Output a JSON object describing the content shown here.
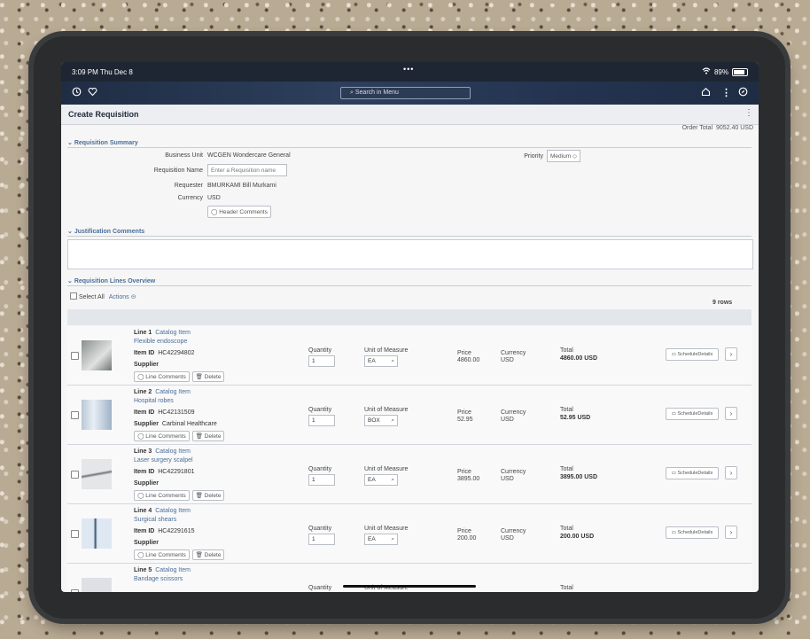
{
  "status": {
    "time": "3:09 PM  Thu Dec 8",
    "dots": "•••",
    "battery": "89%"
  },
  "nav": {
    "search_placeholder": "Search in Menu"
  },
  "page": {
    "title": "Create Requisition",
    "order_total_label": "Order Total",
    "order_total_value": "9052.40 USD"
  },
  "summary": {
    "heading": "Requisition Summary",
    "business_unit_label": "Business Unit",
    "business_unit_value": "WCGEN   Wondercare General",
    "req_name_label": "Requisition Name",
    "req_name_placeholder": "Enter a Requisition name",
    "requester_label": "Requester",
    "requester_value": "BMURKAMI   Bill Murkami",
    "currency_label": "Currency",
    "currency_value": "USD",
    "header_comments_label": "Header Comments",
    "priority_label": "Priority",
    "priority_value": "Medium"
  },
  "justification": {
    "heading": "Justification Comments"
  },
  "lines_overview": {
    "heading": "Requisition Lines Overview",
    "select_all": "Select All",
    "actions": "Actions",
    "rows": "9 rows"
  },
  "labels": {
    "item_id": "Item ID",
    "supplier": "Supplier",
    "quantity": "Quantity",
    "uom": "Unit of Measure",
    "price": "Price",
    "currency": "Currency",
    "total": "Total",
    "line_comments": "Line Comments",
    "delete": "Delete",
    "schedule": "ScheduleDetails"
  },
  "lines": [
    {
      "line": "Line 1",
      "type": "Catalog Item",
      "desc": "Flexible endoscope",
      "item_id": "HC42294802",
      "supplier": "",
      "qty": "1",
      "uom": "EA",
      "price": "4860.00",
      "currency": "USD",
      "total": "4860.00 USD"
    },
    {
      "line": "Line 2",
      "type": "Catalog Item",
      "desc": "Hospital robes",
      "item_id": "HC42131509",
      "supplier": "Carbinal Healthcare",
      "qty": "1",
      "uom": "BOX",
      "price": "52.95",
      "currency": "USD",
      "total": "52.95 USD"
    },
    {
      "line": "Line 3",
      "type": "Catalog Item",
      "desc": "Laser surgery scalpel",
      "item_id": "HC42291801",
      "supplier": "",
      "qty": "1",
      "uom": "EA",
      "price": "3895.00",
      "currency": "USD",
      "total": "3895.00 USD"
    },
    {
      "line": "Line 4",
      "type": "Catalog Item",
      "desc": "Surgical shears",
      "item_id": "HC42291615",
      "supplier": "",
      "qty": "1",
      "uom": "EA",
      "price": "200.00",
      "currency": "USD",
      "total": "200.00 USD"
    },
    {
      "line": "Line 5",
      "type": "Catalog Item",
      "desc": "Bandage scissors",
      "item_id": "",
      "supplier": "",
      "qty": "",
      "uom": "",
      "price": "",
      "currency": "",
      "total": ""
    }
  ]
}
